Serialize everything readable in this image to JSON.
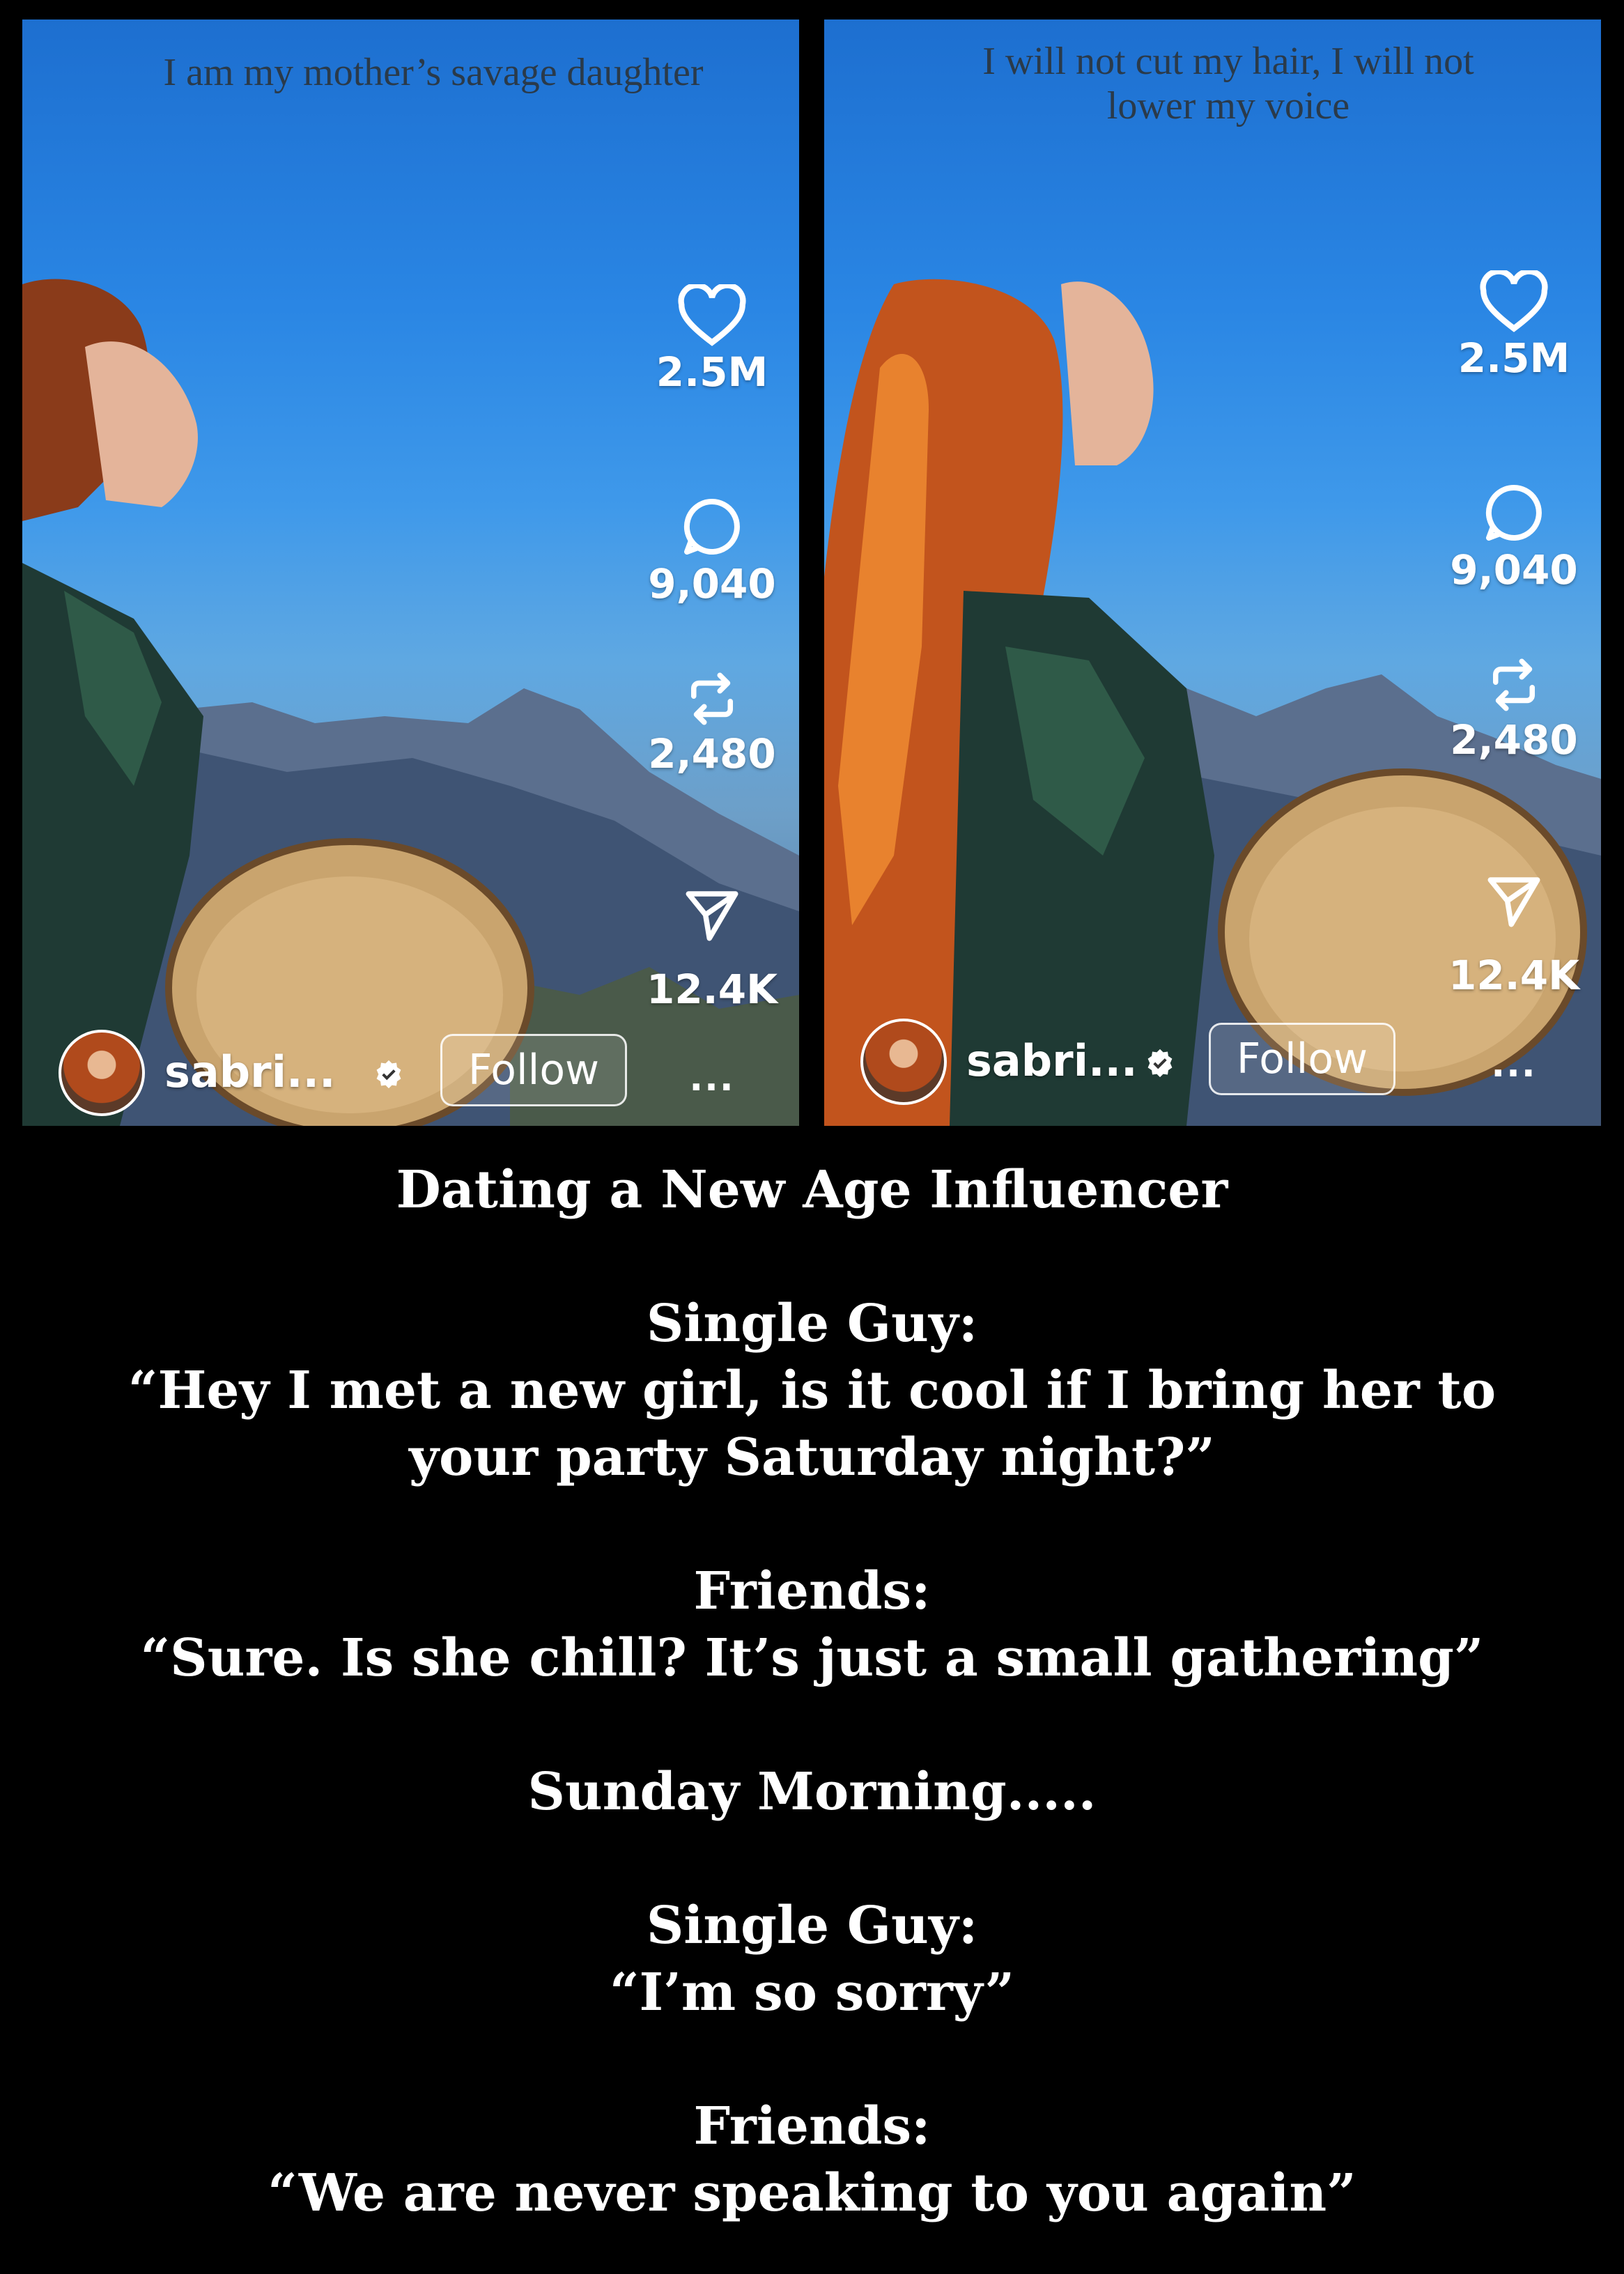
{
  "panels": [
    {
      "caption": "I am my mother’s savage daughter",
      "likes": "2.5M",
      "comments": "9,040",
      "reposts": "2,480",
      "shares": "12.4K",
      "more": "...",
      "username": "sabri...",
      "follow_label": "Follow"
    },
    {
      "caption": "I will not cut my hair, I will not lower my voice",
      "likes": "2.5M",
      "comments": "9,040",
      "reposts": "2,480",
      "shares": "12.4K",
      "more": "...",
      "username": "sabri...",
      "follow_label": "Follow"
    }
  ],
  "meme": {
    "title": "Dating a New Age Influencer",
    "single_guy_label_1": "Single Guy:",
    "single_guy_quote_1a": "“Hey I met a new girl, is it cool if I bring her to",
    "single_guy_quote_1b": "your party Saturday night?”",
    "friends_label_1": "Friends:",
    "friends_quote_1": "“Sure.  Is she chill? It’s just a small gathering”",
    "sunday": "Sunday Morning.....",
    "single_guy_label_2": "Single Guy:",
    "single_guy_quote_2": "“I’m so sorry”",
    "friends_label_2": "Friends:",
    "friends_quote_2": "“We are never speaking to you again”"
  },
  "icons": {
    "like": "heart-icon",
    "comment": "comment-bubble-icon",
    "repost": "repost-icon",
    "share": "send-icon",
    "verified": "verified-badge-icon"
  }
}
